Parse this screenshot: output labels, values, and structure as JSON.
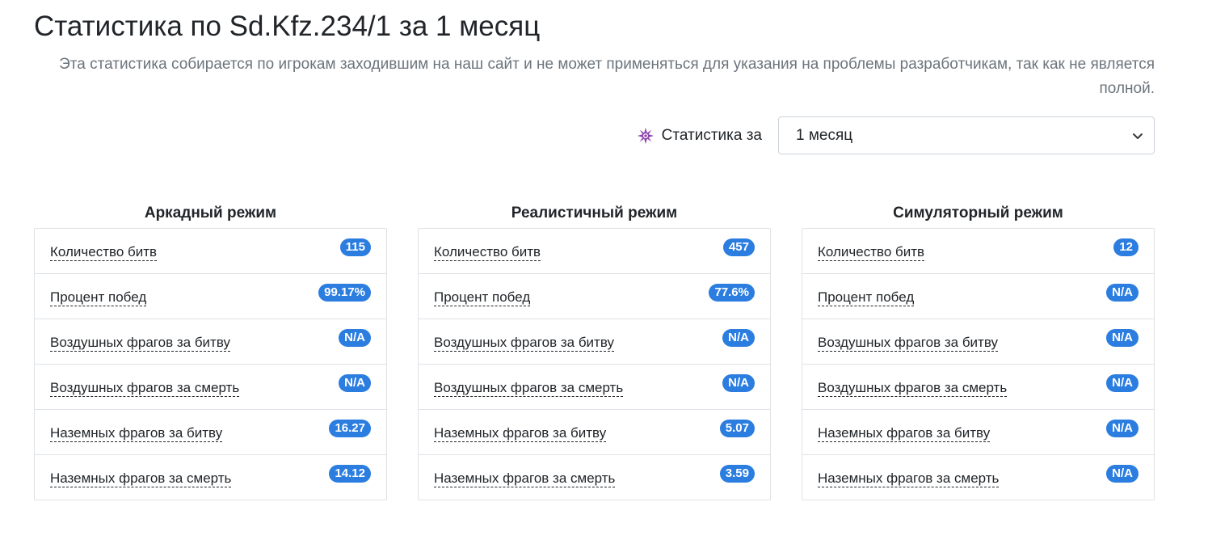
{
  "header": {
    "title": "Статистика по Sd.Kfz.234/1 за 1 месяц",
    "subtitle": "Эта статистика собирается по игрокам заходившим на наш сайт и не может применяться для указания на проблемы разработчикам, так как не является полной."
  },
  "period": {
    "icon": "sparkle-icon",
    "label": "Статистика за",
    "selected": "1 месяц"
  },
  "colors": {
    "badge": "#2b7de0",
    "icon": "#8e44ad",
    "subtitle": "#6c757d"
  },
  "modes": [
    {
      "title": "Аркадный режим",
      "stats": [
        {
          "label": "Количество битв",
          "value": "115"
        },
        {
          "label": "Процент побед",
          "value": "99.17%"
        },
        {
          "label": "Воздушных фрагов за битву",
          "value": "N/A"
        },
        {
          "label": "Воздушных фрагов за смерть",
          "value": "N/A"
        },
        {
          "label": "Наземных фрагов за битву",
          "value": "16.27"
        },
        {
          "label": "Наземных фрагов за смерть",
          "value": "14.12"
        }
      ]
    },
    {
      "title": "Реалистичный режим",
      "stats": [
        {
          "label": "Количество битв",
          "value": "457"
        },
        {
          "label": "Процент побед",
          "value": "77.6%"
        },
        {
          "label": "Воздушных фрагов за битву",
          "value": "N/A"
        },
        {
          "label": "Воздушных фрагов за смерть",
          "value": "N/A"
        },
        {
          "label": "Наземных фрагов за битву",
          "value": "5.07"
        },
        {
          "label": "Наземных фрагов за смерть",
          "value": "3.59"
        }
      ]
    },
    {
      "title": "Симуляторный режим",
      "stats": [
        {
          "label": "Количество битв",
          "value": "12"
        },
        {
          "label": "Процент побед",
          "value": "N/A"
        },
        {
          "label": "Воздушных фрагов за битву",
          "value": "N/A"
        },
        {
          "label": "Воздушных фрагов за смерть",
          "value": "N/A"
        },
        {
          "label": "Наземных фрагов за битву",
          "value": "N/A"
        },
        {
          "label": "Наземных фрагов за смерть",
          "value": "N/A"
        }
      ]
    }
  ]
}
